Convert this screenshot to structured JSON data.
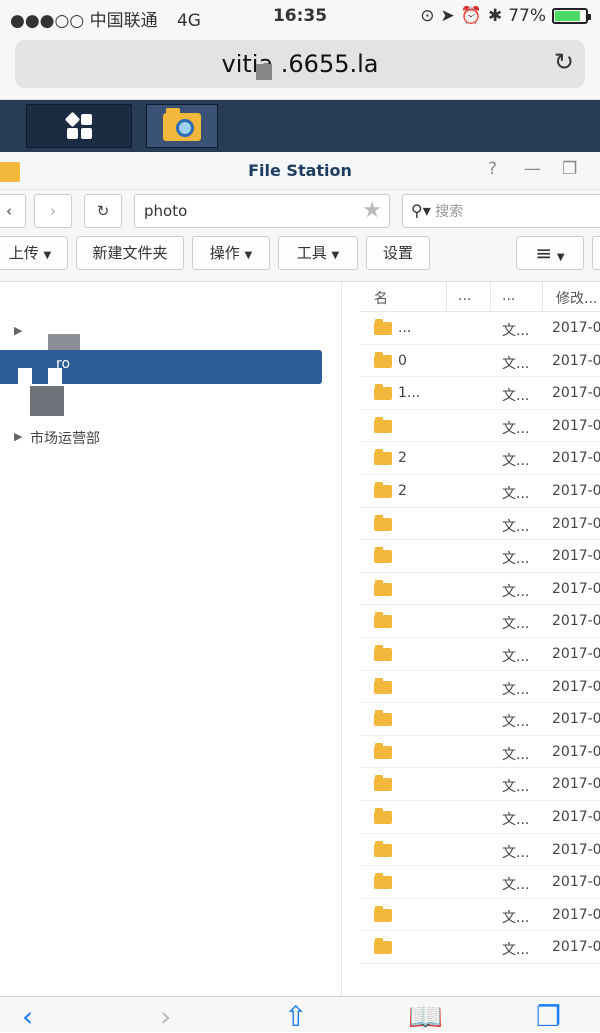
{
  "status_bar": {
    "carrier": "●●●○○ 中国联通",
    "network": "4G",
    "time": "16:35",
    "battery": "77%"
  },
  "url_bar": {
    "url": "vitia      .6655.la"
  },
  "window": {
    "title": "File Station"
  },
  "nav": {
    "path": "photo",
    "search_placeholder": "搜索"
  },
  "toolbar": {
    "upload": "上传",
    "new_folder": "新建文件夹",
    "action": "操作",
    "tools": "工具",
    "settings": "设置"
  },
  "tree": {
    "selected_label": "ro",
    "item_marketing": "市场运营部"
  },
  "file_list": {
    "columns": [
      "名",
      "...",
      "...",
      "修改..."
    ],
    "rows": [
      {
        "name": "...",
        "type": "文...",
        "date": "2017-0"
      },
      {
        "name": "0",
        "type": "文...",
        "date": "2017-0"
      },
      {
        "name": "1...",
        "type": "文...",
        "date": "2017-0"
      },
      {
        "name": "",
        "type": "文...",
        "date": "2017-0"
      },
      {
        "name": "2",
        "type": "文...",
        "date": "2017-0"
      },
      {
        "name": "2",
        "type": "文...",
        "date": "2017-0"
      },
      {
        "name": "",
        "type": "文...",
        "date": "2017-0"
      },
      {
        "name": "",
        "type": "文...",
        "date": "2017-0"
      },
      {
        "name": "",
        "type": "文...",
        "date": "2017-0"
      },
      {
        "name": "",
        "type": "文...",
        "date": "2017-0"
      },
      {
        "name": "",
        "type": "文...",
        "date": "2017-0"
      },
      {
        "name": "",
        "type": "文...",
        "date": "2017-0"
      },
      {
        "name": "",
        "type": "文...",
        "date": "2017-0"
      },
      {
        "name": "",
        "type": "文...",
        "date": "2017-0"
      },
      {
        "name": "",
        "type": "文...",
        "date": "2017-0"
      },
      {
        "name": "",
        "type": "文...",
        "date": "2017-0"
      },
      {
        "name": "",
        "type": "文...",
        "date": "2017-0"
      },
      {
        "name": "",
        "type": "文...",
        "date": "2017-0"
      },
      {
        "name": "",
        "type": "文...",
        "date": "2017-0"
      },
      {
        "name": "",
        "type": "文...",
        "date": "2017-0"
      }
    ]
  },
  "colors": {
    "taskbar": "#273b55",
    "selection": "#2b5d96",
    "folder": "#f3b73b",
    "accent": "#1a7cf6"
  }
}
